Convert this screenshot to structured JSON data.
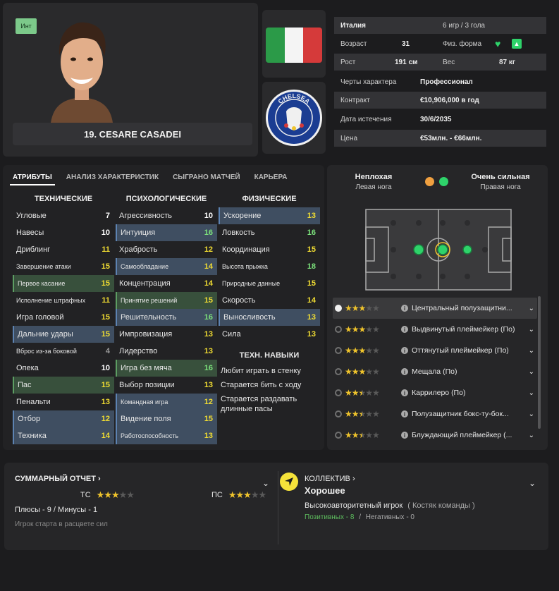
{
  "player": {
    "badge": "Инт",
    "name": "19. CESARE CASADEI"
  },
  "info": {
    "nation": "Италия",
    "caps": "6 игр / 3 гола",
    "age_label": "Возраст",
    "age": "31",
    "fitness_label": "Физ. форма",
    "height_label": "Рост",
    "height": "191 см",
    "weight_label": "Вес",
    "weight": "87 кг",
    "personality_label": "Черты характера",
    "personality": "Профессионал",
    "contract_label": "Контракт",
    "contract": "€10,906,000 в год",
    "expiry_label": "Дата истечения",
    "expiry": "30/6/2035",
    "price_label": "Цена",
    "price": "€53млн. - €66млн."
  },
  "tabs": [
    "АТРИБУТЫ",
    "АНАЛИЗ ХАРАКТЕРИСТИК",
    "СЫГРАНО МАТЧЕЙ",
    "КАРЬЕРА"
  ],
  "attributes": {
    "technical_title": "ТЕХНИЧЕСКИЕ",
    "mental_title": "ПСИХОЛОГИЧЕСКИЕ",
    "physical_title": "ФИЗИЧЕСКИЕ",
    "technical": [
      {
        "label": "Угловые",
        "value": "7"
      },
      {
        "label": "Навесы",
        "value": "10"
      },
      {
        "label": "Дриблинг",
        "value": "11"
      },
      {
        "label": "Завершение атаки",
        "value": "15"
      },
      {
        "label": "Первое касание",
        "value": "15"
      },
      {
        "label": "Исполнение штрафных",
        "value": "11"
      },
      {
        "label": "Игра головой",
        "value": "15"
      },
      {
        "label": "Дальние удары",
        "value": "15"
      },
      {
        "label": "Вброс из-за боковой",
        "value": "4"
      },
      {
        "label": "Опека",
        "value": "10"
      },
      {
        "label": "Пас",
        "value": "15"
      },
      {
        "label": "Пенальти",
        "value": "13"
      },
      {
        "label": "Отбор",
        "value": "12"
      },
      {
        "label": "Техника",
        "value": "14"
      }
    ],
    "mental": [
      {
        "label": "Агрессивность",
        "value": "10"
      },
      {
        "label": "Интуиция",
        "value": "16"
      },
      {
        "label": "Храбрость",
        "value": "12"
      },
      {
        "label": "Самообладание",
        "value": "14"
      },
      {
        "label": "Концентрация",
        "value": "14"
      },
      {
        "label": "Принятие решений",
        "value": "15"
      },
      {
        "label": "Решительность",
        "value": "16"
      },
      {
        "label": "Импровизация",
        "value": "13"
      },
      {
        "label": "Лидерство",
        "value": "13"
      },
      {
        "label": "Игра без мяча",
        "value": "16"
      },
      {
        "label": "Выбор позиции",
        "value": "13"
      },
      {
        "label": "Командная игра",
        "value": "12"
      },
      {
        "label": "Видение поля",
        "value": "15"
      },
      {
        "label": "Работоспособность",
        "value": "13"
      }
    ],
    "physical": [
      {
        "label": "Ускорение",
        "value": "13"
      },
      {
        "label": "Ловкость",
        "value": "16"
      },
      {
        "label": "Координация",
        "value": "15"
      },
      {
        "label": "Высота прыжка",
        "value": "18"
      },
      {
        "label": "Природные данные",
        "value": "15"
      },
      {
        "label": "Скорость",
        "value": "14"
      },
      {
        "label": "Выносливость",
        "value": "13"
      },
      {
        "label": "Сила",
        "value": "13"
      }
    ],
    "skills_title": "ТЕХН. НАВЫКИ",
    "skills": [
      "Любит играть в стенку",
      "Старается бить с ходу",
      "Старается раздавать длинные пасы"
    ]
  },
  "feet": {
    "left_rating": "Неплохая",
    "left_label": "Левая нога",
    "right_rating": "Очень сильная",
    "right_label": "Правая нога",
    "left_color": "#f0a040",
    "right_color": "#2ed36a"
  },
  "roles": [
    {
      "stars": 3,
      "label": "Центральный полузащитни..."
    },
    {
      "stars": 3,
      "label": "Выдвинутый плеймейкер (По)"
    },
    {
      "stars": 3,
      "label": "Оттянутый плеймейкер (По)"
    },
    {
      "stars": 3,
      "label": "Мещала (По)"
    },
    {
      "stars": 2.5,
      "label": "Каррилеро (По)"
    },
    {
      "stars": 2.5,
      "label": "Полузащитник бокс-ту-бок..."
    },
    {
      "stars": 2.5,
      "label": "Блуждающий плеймейкер (..."
    }
  ],
  "summary": {
    "title": "СУММАРНЫЙ ОТЧЕТ",
    "tc_label": "ТС",
    "tc_stars": 3,
    "pc_label": "ПС",
    "pc_stars": 3,
    "pros_cons": "Плюсы - 9 / Минусы - 1",
    "note": "Игрок старта в расцвете сил"
  },
  "team": {
    "title": "КОЛЛЕКТИВ",
    "status": "Хорошее",
    "role": "Высокоавторитетный игрок",
    "role_note": "( Костяк команды )",
    "positive": "Позитивных - 8",
    "sep": "/",
    "negative": "Негативных - 0"
  }
}
